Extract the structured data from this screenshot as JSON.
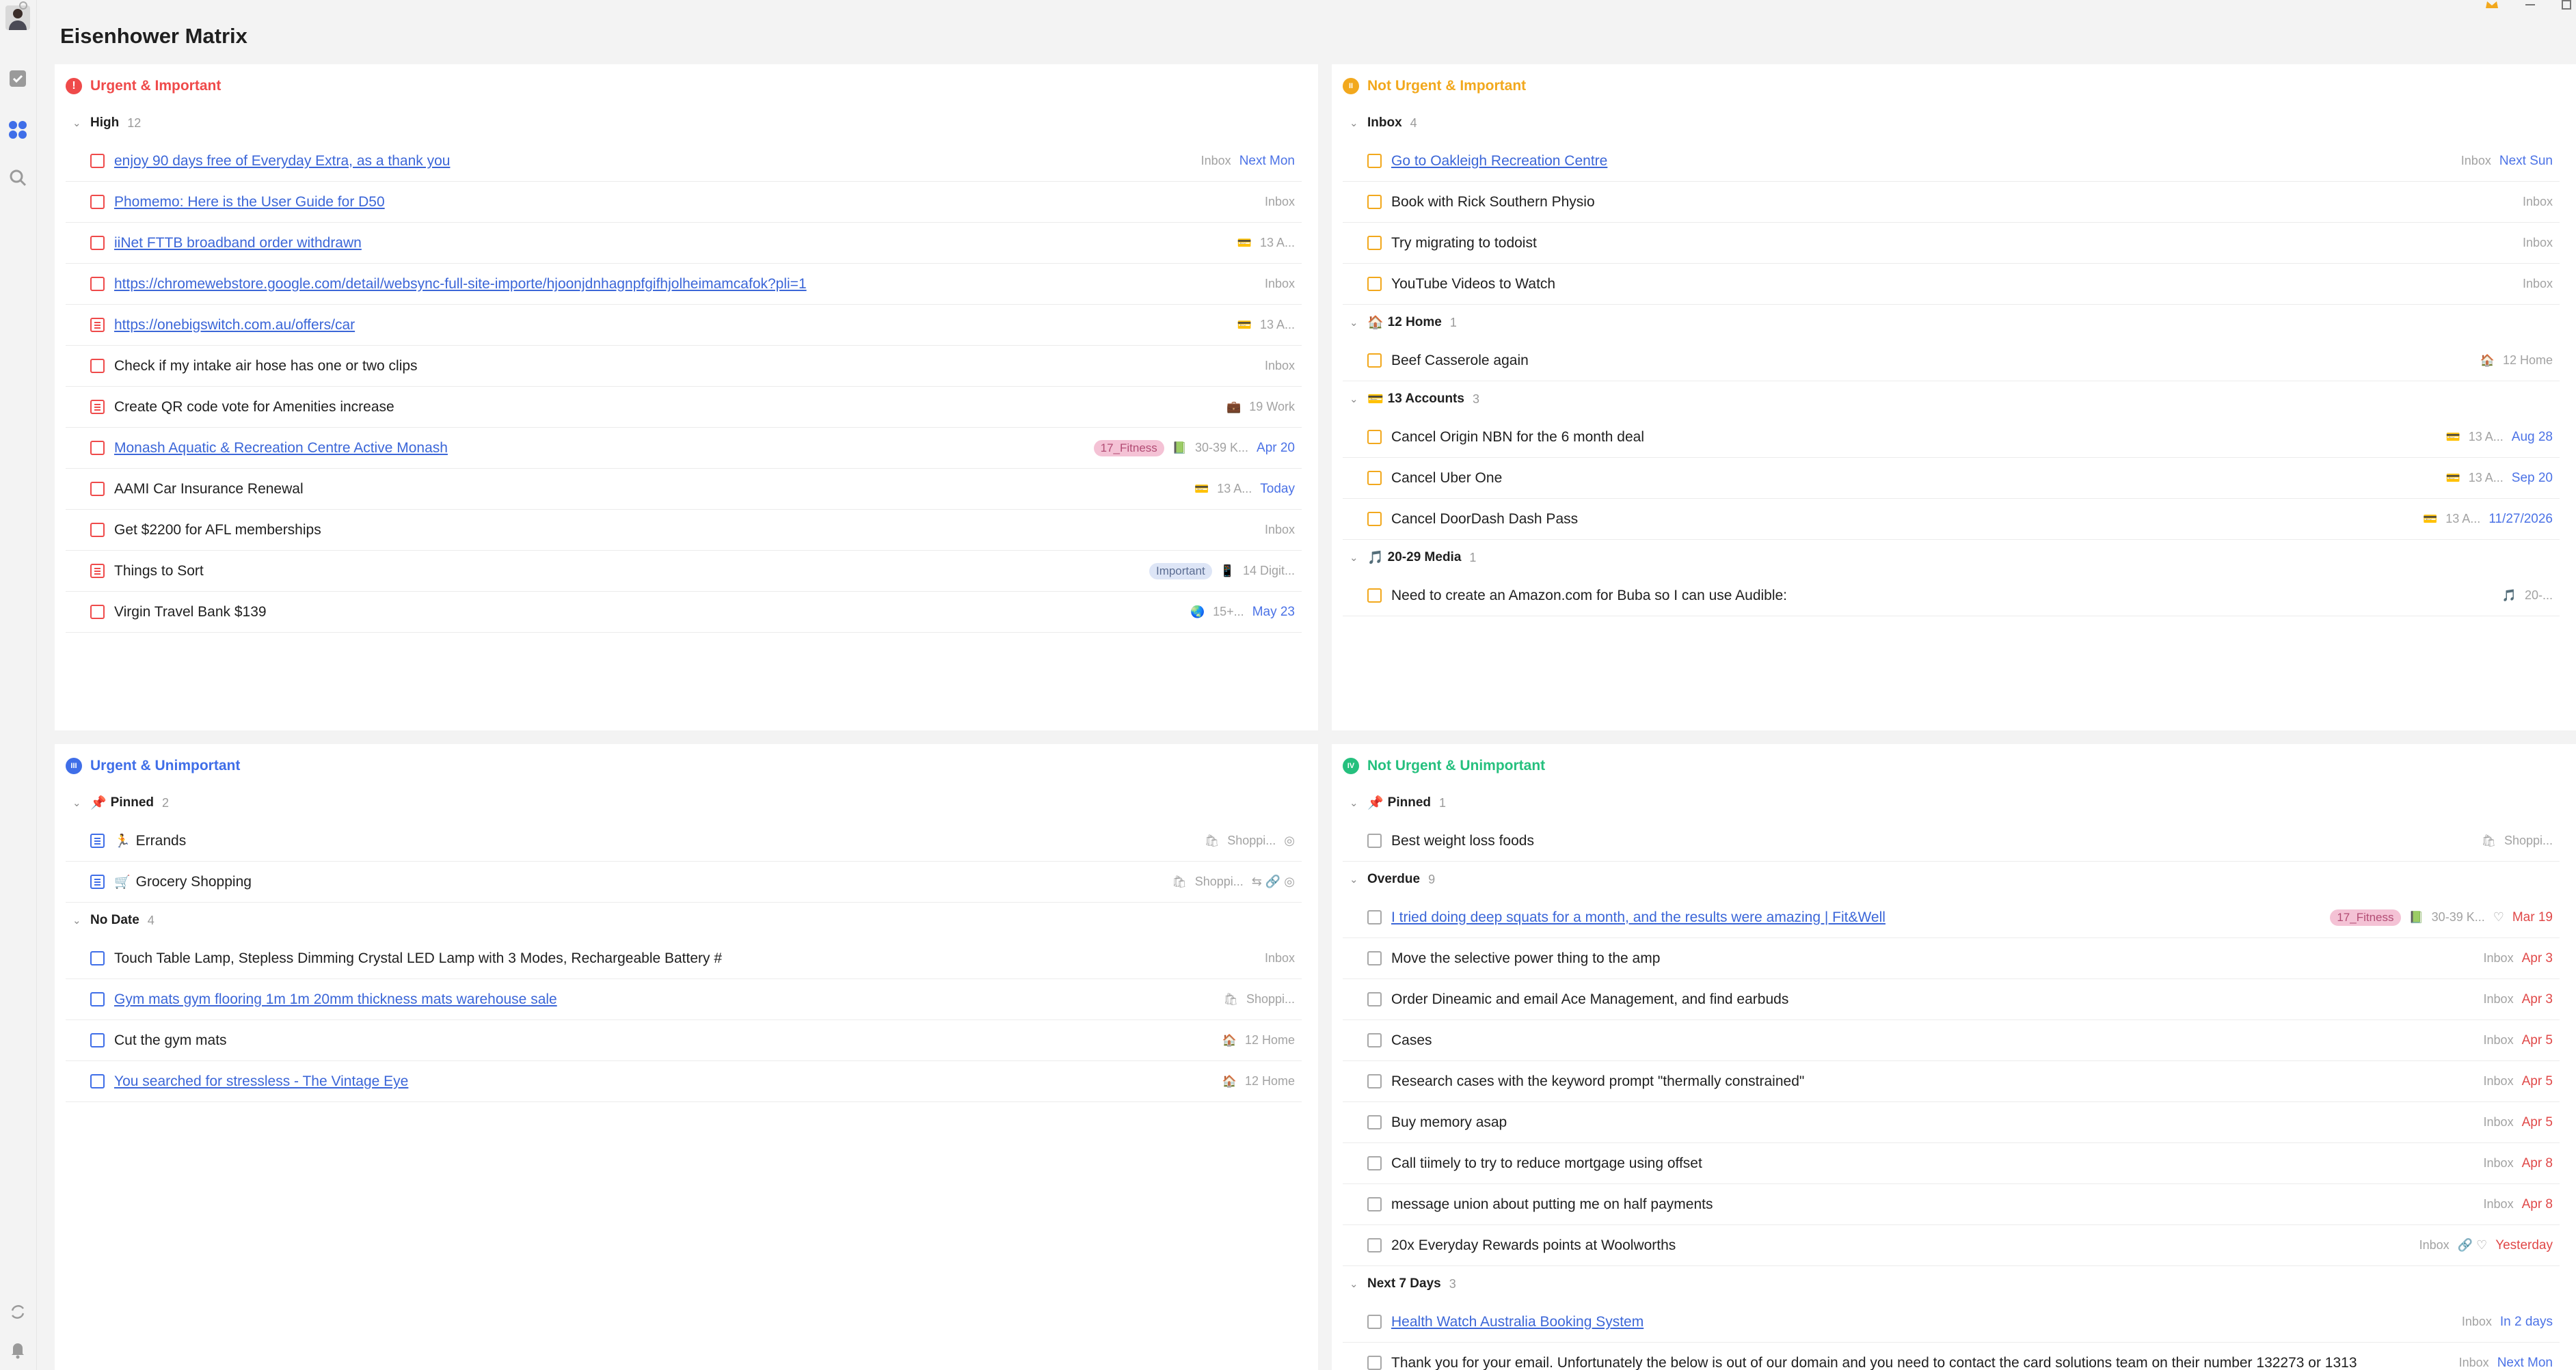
{
  "app": {
    "title": "Eisenhower Matrix"
  },
  "icons": {
    "avatar": "avatar",
    "settings": "settings-gear-icon",
    "task": "task-checkbox-icon",
    "matrix": "matrix-grid-icon",
    "search": "search-icon",
    "sync": "sync-icon",
    "bell": "bell-icon",
    "crown": "crown-icon",
    "minimize": "minimize-icon",
    "maximize": "maximize-icon"
  },
  "colors": {
    "urgent_important": "#ef4a4a",
    "not_urgent_important": "#f2a81d",
    "urgent_unimportant": "#3f6ee8",
    "not_urgent_unimportant": "#25c07e",
    "accent_link": "#3b66d8",
    "overdue": "#e04848",
    "date_blue": "#4b72e6"
  },
  "quadrants": [
    {
      "key": "ui",
      "title": "Urgent & Important",
      "color": "#ef4a4a",
      "icon_glyph": "!",
      "groups": [
        {
          "name": "High",
          "count": "12",
          "tasks": [
            {
              "title": "enjoy 90 days free of Everyday Extra, as a thank you",
              "link": true,
              "list": "Inbox",
              "due": "Next Mon",
              "due_color": "blue"
            },
            {
              "title": "Phomemo: Here is the User Guide for D50",
              "link": true,
              "list": "Inbox"
            },
            {
              "title": "iiNet FTTB broadband order withdrawn",
              "link": true,
              "list_icon": "💳",
              "list": "13 A..."
            },
            {
              "title": "https://chromewebstore.google.com/detail/websync-full-site-importe/hjoonjdnhagnpfgifhjolheimamcafok?pli=1",
              "link": true,
              "list": "Inbox"
            },
            {
              "title": "https://onebigswitch.com.au/offers/car",
              "link": true,
              "note": true,
              "list_icon": "💳",
              "list": "13 A..."
            },
            {
              "title": "Check if my intake air hose has one or two clips",
              "list": "Inbox"
            },
            {
              "title": "Create QR code vote for Amenities increase",
              "note": true,
              "list_icon": "💼",
              "list": "19 Work"
            },
            {
              "title": "Monash Aquatic & Recreation Centre Active Monash",
              "link": true,
              "tag": "17_Fitness",
              "list_icon": "📗",
              "list": "30-39 K...",
              "due": "Apr 20",
              "due_color": "blue"
            },
            {
              "title": "AAMI Car Insurance Renewal",
              "list_icon": "💳",
              "list": "13 A...",
              "due": "Today",
              "due_color": "blue"
            },
            {
              "title": "Get $2200 for AFL memberships",
              "list": "Inbox"
            },
            {
              "title": "Things to Sort",
              "note": true,
              "tag": "Important",
              "tag_kind": "imp",
              "list_icon": "📱",
              "list": "14 Digit..."
            },
            {
              "title": "Virgin Travel Bank $139",
              "list_icon": "🌏",
              "list": "15+...",
              "due": "May 23",
              "due_color": "blue"
            }
          ]
        }
      ]
    },
    {
      "key": "nui",
      "title": "Not Urgent & Important",
      "color": "#f2a81d",
      "icon_glyph": "II",
      "groups": [
        {
          "name": "Inbox",
          "count": "4",
          "tasks": [
            {
              "title": "Go to Oakleigh Recreation Centre",
              "link": true,
              "list": "Inbox",
              "due": "Next Sun",
              "due_color": "blue"
            },
            {
              "title": "Book with Rick Southern Physio",
              "list": "Inbox"
            },
            {
              "title": "Try migrating to todoist",
              "list": "Inbox"
            },
            {
              "title": "YouTube Videos to Watch",
              "list": "Inbox"
            }
          ]
        },
        {
          "icon": "🏠",
          "name": "12 Home",
          "count": "1",
          "tasks": [
            {
              "title": "Beef Casserole again",
              "list_icon": "🏠",
              "list": "12 Home"
            }
          ]
        },
        {
          "icon": "💳",
          "name": "13 Accounts",
          "count": "3",
          "tasks": [
            {
              "title": "Cancel Origin NBN  for the 6 month deal",
              "list_icon": "💳",
              "list": "13 A...",
              "due": "Aug 28",
              "due_color": "blue"
            },
            {
              "title": "Cancel Uber One",
              "list_icon": "💳",
              "list": "13 A...",
              "due": "Sep 20",
              "due_color": "blue"
            },
            {
              "title": "Cancel DoorDash Dash Pass",
              "list_icon": "💳",
              "list": "13 A...",
              "due": "11/27/2026",
              "due_color": "blue"
            }
          ]
        },
        {
          "icon": "🎵",
          "name": "20-29 Media",
          "count": "1",
          "tasks": [
            {
              "title": "Need to create an Amazon.com for Buba so I can use Audible:",
              "list_icon": "🎵",
              "list": "20-..."
            }
          ]
        }
      ]
    },
    {
      "key": "uu",
      "title": "Urgent & Unimportant",
      "color": "#3f6ee8",
      "icon_glyph": "III",
      "groups": [
        {
          "icon": "📌",
          "name": "Pinned",
          "count": "2",
          "tasks": [
            {
              "title": "Errands",
              "title_icon": "🏃",
              "note": true,
              "list_icon": "🛍",
              "list": "Shoppi...",
              "extra": "◎"
            },
            {
              "title": "Grocery Shopping",
              "title_icon": "🛒",
              "note": true,
              "list_icon": "🛍",
              "list": "Shoppi...",
              "extra": "⇆ 🔗 ◎"
            }
          ]
        },
        {
          "name": "No Date",
          "count": "4",
          "tasks": [
            {
              "title": "Touch Table Lamp, Stepless Dimming Crystal LED Lamp with 3 Modes, Rechargeable Battery  #",
              "list": "Inbox"
            },
            {
              "title": "Gym mats gym flooring 1m 1m 20mm thickness mats warehouse sale",
              "link": true,
              "list_icon": "🛍",
              "list": "Shoppi..."
            },
            {
              "title": "Cut the gym mats",
              "list_icon": "🏠",
              "list": "12 Home"
            },
            {
              "title": "You searched for stressless - The Vintage Eye",
              "link": true,
              "list_icon": "🏠",
              "list": "12 Home"
            }
          ]
        }
      ]
    },
    {
      "key": "nuu",
      "title": "Not Urgent & Unimportant",
      "color": "#25c07e",
      "icon_glyph": "IV",
      "groups": [
        {
          "icon": "📌",
          "name": "Pinned",
          "count": "1",
          "tasks": [
            {
              "title": "Best weight loss foods",
              "list_icon": "🛍",
              "list": "Shoppi..."
            }
          ]
        },
        {
          "name": "Overdue",
          "count": "9",
          "tasks": [
            {
              "title": "I tried doing deep squats  for a month, and the results were amazing | Fit&Well",
              "link": true,
              "tag": "17_Fitness",
              "list_icon": "📗",
              "list": "30-39 K...",
              "extra": "♡",
              "due": "Mar 19",
              "due_color": "red"
            },
            {
              "title": "Move the selective power thing to the amp",
              "list": "Inbox",
              "due": "Apr 3",
              "due_color": "red"
            },
            {
              "title": "Order Dineamic and email Ace Management, and find earbuds",
              "list": "Inbox",
              "due": "Apr 3",
              "due_color": "red"
            },
            {
              "title": "Cases",
              "list": "Inbox",
              "due": "Apr 5",
              "due_color": "red"
            },
            {
              "title": "Research cases with the keyword prompt \"thermally constrained\"",
              "list": "Inbox",
              "due": "Apr 5",
              "due_color": "red"
            },
            {
              "title": "Buy memory asap",
              "list": "Inbox",
              "due": "Apr 5",
              "due_color": "red"
            },
            {
              "title": "Call tiimely to try to reduce mortgage using offset",
              "list": "Inbox",
              "due": "Apr 8",
              "due_color": "red"
            },
            {
              "title": "message union about putting me on half payments",
              "list": "Inbox",
              "due": "Apr 8",
              "due_color": "red"
            },
            {
              "title": "20x Everyday Rewards points at Woolworths",
              "list": "Inbox",
              "extra": "🔗 ♡",
              "due": "Yesterday",
              "due_color": "red"
            }
          ]
        },
        {
          "name": "Next 7 Days",
          "count": "3",
          "tasks": [
            {
              "title": "Health Watch Australia Booking System",
              "link": true,
              "list": "Inbox",
              "due": "In 2 days",
              "due_color": "blue"
            },
            {
              "title": "Thank you for your email.   Unfortunately the below is out of our domain and you need to contact the card solutions team on their number 132273 or 1313",
              "list": "Inbox",
              "due": "Next Mon",
              "due_color": "blue"
            }
          ]
        }
      ]
    }
  ]
}
